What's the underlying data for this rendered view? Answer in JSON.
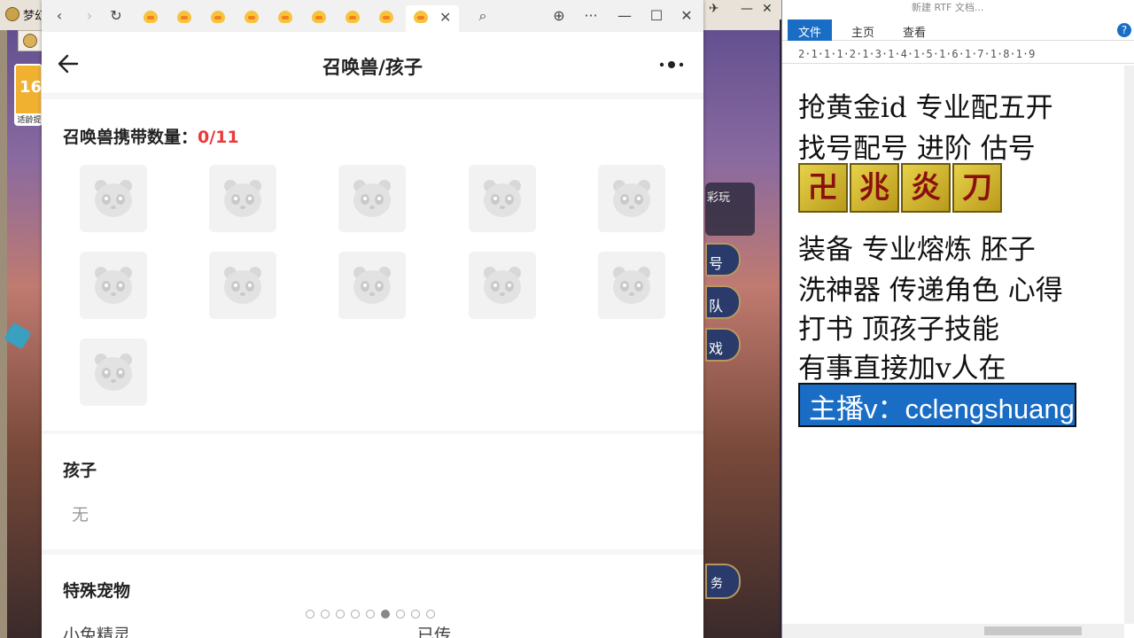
{
  "game": {
    "title": "梦幻",
    "age_badge_num": "16",
    "age_badge_text": "适龄提",
    "panel_play": "彩玩",
    "side_buttons": [
      "号",
      "队",
      "戏"
    ],
    "bottom_button": "务"
  },
  "browser": {
    "toolbar": {
      "back": "‹",
      "forward": "›",
      "refresh": "↻",
      "search": "⌕",
      "globe": "⊕",
      "menu": "···",
      "minimize": "—",
      "maximize": "☐",
      "close": "✕",
      "tab_close": "✕"
    },
    "page_title": "召唤兽/孩子",
    "pets": {
      "label": "召唤兽携带数量：",
      "count": "0/11"
    },
    "kids": {
      "title": "孩子",
      "value": "无"
    },
    "special": {
      "title": "特殊宠物",
      "cut_item_1": "小兔精灵",
      "cut_item_2": "已传"
    }
  },
  "mini_bar": {
    "pin": "✈",
    "minimize": "—",
    "close": "✕"
  },
  "wordpad": {
    "title": "新建 RTF 文档...",
    "tabs": [
      "文件",
      "主页",
      "查看"
    ],
    "help": "?",
    "ruler": "2·1·1·1·2·1·3·1·4·1·5·1·6·1·7·1·8·1·9",
    "lines": [
      "抢黄金id 专业配五开",
      "找号配号 进阶 估号",
      "装备 专业熔炼 胚子",
      "洗神器 传递角色 心得",
      "打书 顶孩子技能",
      "有事直接加v人在"
    ],
    "symbols": [
      "卍",
      "兆",
      "炎",
      "刀"
    ],
    "highlight": "主播v：cclengshuang"
  }
}
